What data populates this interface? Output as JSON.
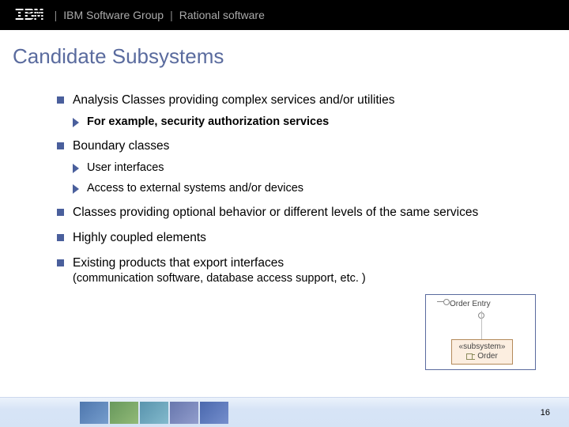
{
  "brand": {
    "name": "IBM"
  },
  "topbar": {
    "group": "IBM Software Group",
    "product": "Rational software",
    "sep": "|"
  },
  "title": "Candidate Subsystems",
  "bullets": {
    "b1": {
      "text": "Analysis Classes providing complex services and/or utilities",
      "sub": [
        {
          "text": "For example, security authorization services",
          "bold": true
        }
      ]
    },
    "b2": {
      "text": "Boundary classes",
      "sub": [
        {
          "text": "User interfaces"
        },
        {
          "text": "Access to external systems and/or devices"
        }
      ]
    },
    "b3": {
      "text": "Classes providing optional behavior or different levels of the same services"
    },
    "b4": {
      "text": "Highly coupled elements"
    },
    "b5": {
      "text": "Existing products that export interfaces",
      "paren": "(communication software, database access support, etc. )"
    }
  },
  "inset": {
    "interface": "Order Entry",
    "stereotype": "«subsystem»",
    "classname": "Order"
  },
  "footer": {
    "page": "16"
  }
}
